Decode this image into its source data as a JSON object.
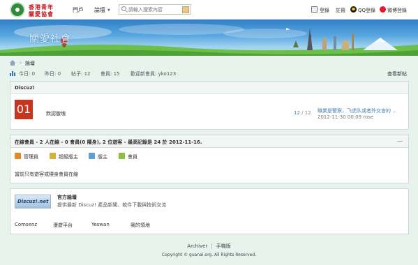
{
  "header": {
    "logo_line1": "香港青年",
    "logo_line2": "關愛協會",
    "nav": {
      "portal": "門戶",
      "forum": "論壇"
    },
    "search": {
      "placeholder": "請輸入搜索內容"
    },
    "links": {
      "login": "登錄",
      "register": "註冊",
      "qq": "QQ登錄",
      "weibo": "微博登錄"
    }
  },
  "banner": {
    "title": "關愛社會"
  },
  "breadcrumb": {
    "forum": "論壇"
  },
  "stats": {
    "today": "今日: 0",
    "yesterday": "昨日: 0",
    "posts": "帖子: 12",
    "members": "會員: 15",
    "welcome": "歡迎新會員: yko123",
    "view_new": "查看新帖"
  },
  "forum_group": {
    "title": "Discuz!",
    "forum": {
      "icon_number": "01",
      "name": "默認版塊",
      "count_a": "12",
      "count_sep": " / ",
      "count_b": "12",
      "last_post_title": "職業是警察，飞虎队或者外交官的 ...",
      "last_post_meta": "2012-11-30 00:09 rose"
    }
  },
  "online": {
    "title": "在線會員 - 2 人在線 - 0 會員(0 隱身), 2 位遊客 - 最高記錄是 24 於 2012-11-16.",
    "collapse": "—",
    "legend": [
      "管理員",
      "超級版主",
      "版主",
      "會員"
    ],
    "legend_colors": [
      "#e08a2a",
      "#d6b23a",
      "#5aa0d6",
      "#8cbf3f"
    ],
    "note": "當前只有遊客或隱身會員在線"
  },
  "links_box": {
    "logo_text": "Discuz!.net",
    "official_title": "官方論壇",
    "official_desc": "提供最新 Discuz! 產品新聞、軟件下載與技術交流",
    "friend_links": [
      "Comsenz",
      "漫遊平台",
      "Yeswan",
      "我的領地"
    ]
  },
  "footer": {
    "archiver": "Archiver",
    "mobile": "手機版",
    "sep": "|",
    "copyright": "Copyright © guanai.org. All Rights Reserved."
  }
}
